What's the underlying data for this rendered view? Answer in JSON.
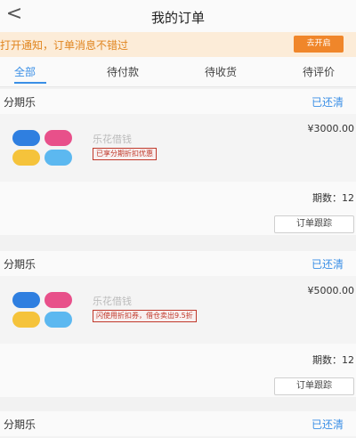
{
  "header": {
    "back_label": "<",
    "title": "我的订单"
  },
  "notice": {
    "text": "打开通知，订单消息不错过",
    "button": "去开启"
  },
  "tabs": [
    {
      "label": "全部"
    },
    {
      "label": "待付款"
    },
    {
      "label": "待收货"
    },
    {
      "label": "待评价"
    }
  ],
  "colors": {
    "accent": "#3a8fe6",
    "notice_bg": "#fcecd8",
    "notice_text": "#e0851f",
    "notice_button": "#f0862a",
    "promo": "#c0392b"
  },
  "orders": [
    {
      "seller": "分期乐",
      "status": "已还清",
      "product": "乐花借钱",
      "promo": "已享分期折扣优惠",
      "price": "¥3000.00",
      "periods": "期数：12",
      "track_label": "订单跟踪"
    },
    {
      "seller": "分期乐",
      "status": "已还清",
      "product": "乐花借钱",
      "promo": "闪使用折扣券，借仓卖出9.5折",
      "price": "¥5000.00",
      "periods": "期数：12",
      "track_label": "订单跟踪"
    },
    {
      "seller": "分期乐",
      "status": "已还清"
    }
  ]
}
